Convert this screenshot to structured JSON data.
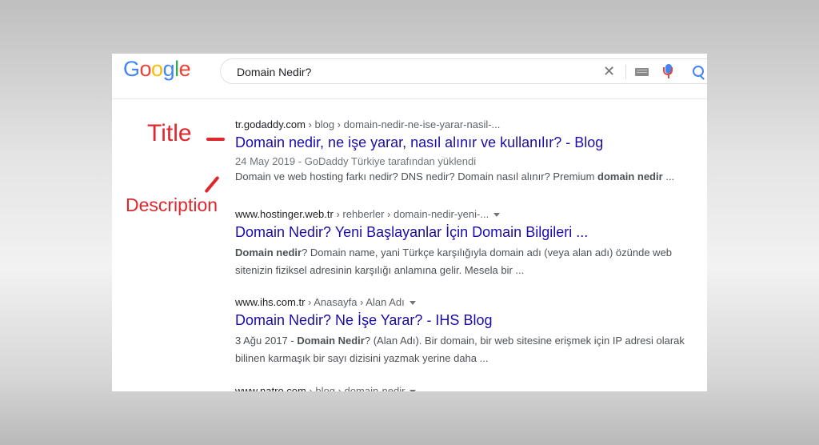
{
  "search": {
    "logo_letters": [
      {
        "ch": "G",
        "color": "#4285f4"
      },
      {
        "ch": "o",
        "color": "#ea4335"
      },
      {
        "ch": "o",
        "color": "#fbbc05"
      },
      {
        "ch": "g",
        "color": "#4285f4"
      },
      {
        "ch": "l",
        "color": "#34a853"
      },
      {
        "ch": "e",
        "color": "#ea4335"
      }
    ],
    "query": "Domain Nedir?",
    "clear_glyph": "✕",
    "icons": [
      "close-icon",
      "keyboard-icon",
      "microphone-icon",
      "search-icon"
    ]
  },
  "results": [
    {
      "domain": "tr.godaddy.com",
      "path": " › blog › domain-nedir-ne-ise-yarar-nasil-...",
      "has_caret": false,
      "title": "Domain nedir, ne işe yarar, nasıl alınır ve kullanılır? - Blog",
      "meta": "24 May 2019 - GoDaddy Türkiye tarafından yüklendi",
      "desc_parts": [
        {
          "t": "Domain ve web hosting farkı nedir? DNS nedir? Domain nasıl alınır? Premium ",
          "b": false
        },
        {
          "t": "domain nedir",
          "b": true
        },
        {
          "t": " ...",
          "b": false
        }
      ]
    },
    {
      "domain": "www.hostinger.web.tr",
      "path": " › rehberler › domain-nedir-yeni-...",
      "has_caret": true,
      "title": "Domain Nedir? Yeni Başlayanlar İçin Domain Bilgileri ...",
      "meta": "",
      "desc_parts": [
        {
          "t": "Domain nedir",
          "b": true
        },
        {
          "t": "? Domain name, yani Türkçe karşılığıyla domain adı (veya alan adı) özünde web sitenizin fiziksel adresinin karşılığı anlamına gelir. Mesela bir ...",
          "b": false
        }
      ]
    },
    {
      "domain": "www.ihs.com.tr",
      "path": " › Anasayfa › Alan Adı",
      "has_caret": true,
      "title": "Domain Nedir? Ne İşe Yarar? - IHS Blog",
      "meta": "",
      "desc_parts": [
        {
          "t": "3 Ağu 2017 - ",
          "b": false
        },
        {
          "t": "Domain Nedir",
          "b": true
        },
        {
          "t": "? (Alan Adı). Bir domain, bir web sitesine erişmek için IP adresi olarak bilinen karmaşık bir sayı dizisini yazmak yerine daha ...",
          "b": false
        }
      ]
    },
    {
      "domain": "www.natro.com",
      "path": " › blog › domain-nedir",
      "has_caret": true,
      "title": "",
      "meta": "",
      "desc_parts": []
    }
  ],
  "annotations": {
    "title_label": "Title",
    "description_label": "Description",
    "color": "#e0282c"
  }
}
